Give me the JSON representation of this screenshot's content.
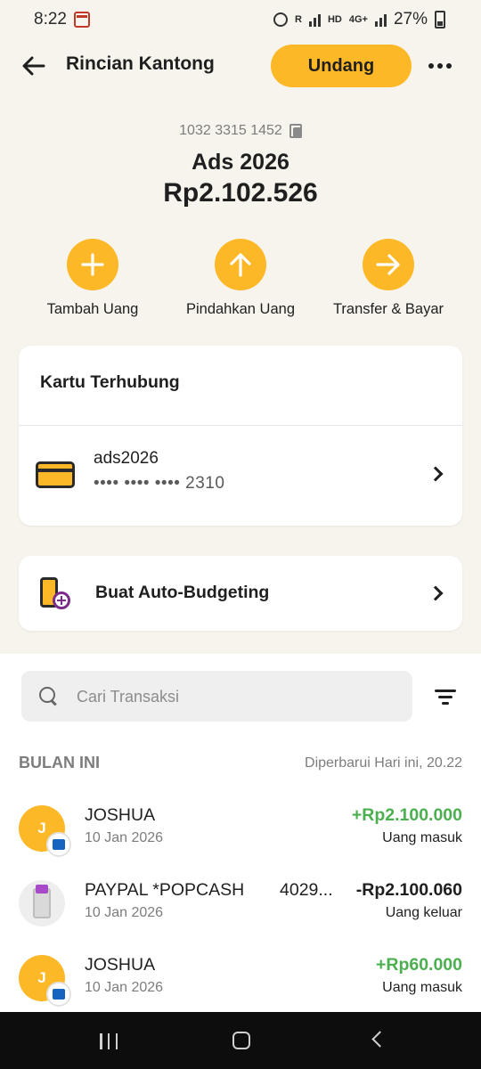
{
  "status": {
    "time": "8:22",
    "battery": "27%",
    "net_labels": [
      "R",
      "HD",
      "4G+"
    ]
  },
  "header": {
    "title": "Rincian Kantong",
    "invite_label": "Undang"
  },
  "pocket": {
    "account_number": "1032 3315 1452",
    "name": "Ads 2026",
    "balance": "Rp2.102.526"
  },
  "actions": [
    {
      "label": "Tambah Uang",
      "icon": "plus-icon"
    },
    {
      "label": "Pindahkan Uang",
      "icon": "arrow-up-icon"
    },
    {
      "label": "Transfer & Bayar",
      "icon": "arrow-right-icon"
    }
  ],
  "linked_card": {
    "title": "Kartu Terhubung",
    "card_name": "ads2026",
    "card_number": "•••• •••• •••• 2310"
  },
  "auto_budget": {
    "label": "Buat Auto-Budgeting"
  },
  "transactions": {
    "search_placeholder": "Cari Transaksi",
    "section_title": "BULAN INI",
    "updated": "Diperbarui Hari ini, 20.22",
    "items": [
      {
        "initial": "J",
        "name": "JOSHUA",
        "extra": "",
        "date": "10 Jan 2026",
        "amount": "+Rp2.100.000",
        "type": "Uang masuk"
      },
      {
        "initial": "",
        "name": "PAYPAL *POPCASH",
        "extra": "4029...",
        "date": "10 Jan 2026",
        "amount": "-Rp2.100.060",
        "type": "Uang keluar"
      },
      {
        "initial": "J",
        "name": "JOSHUA",
        "extra": "",
        "date": "10 Jan 2026",
        "amount": "+Rp60.000",
        "type": "Uang masuk"
      }
    ]
  },
  "colors": {
    "accent": "#FDB827",
    "income": "#4CAF50",
    "background": "#F6F4EC"
  }
}
